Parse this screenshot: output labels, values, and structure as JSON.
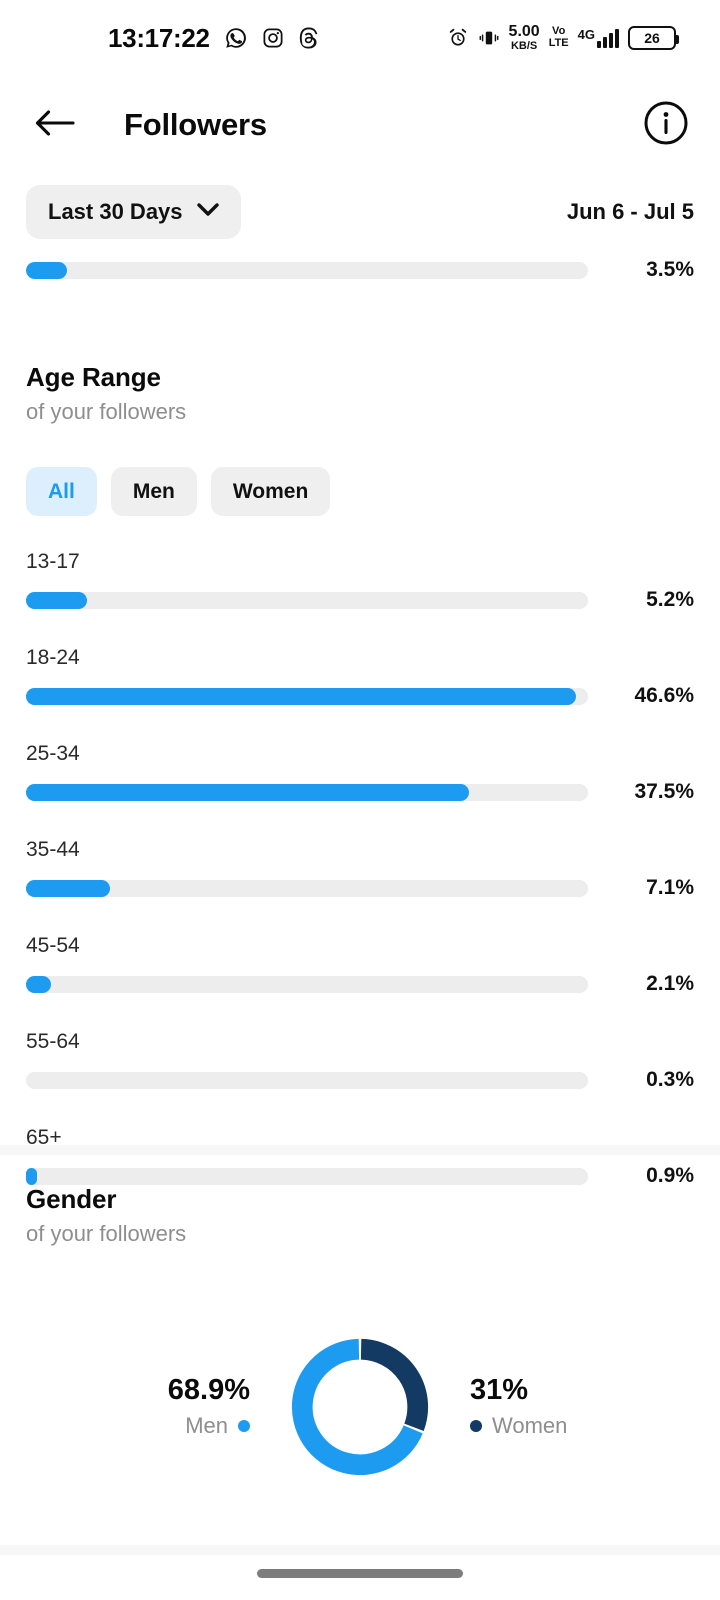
{
  "status_bar": {
    "time": "13:17:22",
    "left_icons": [
      "whatsapp-icon",
      "instagram-icon",
      "threads-icon"
    ],
    "alarm_icon": "alarm-icon",
    "vibrate_icon": "vibrate-icon",
    "net_speed_value": "5.00",
    "net_speed_unit": "KB/S",
    "volte_line1": "Vo",
    "volte_line2": "LTE",
    "network_type": "4G",
    "signal_bars": 4,
    "battery_level": "26"
  },
  "header": {
    "back_icon": "back-arrow-icon",
    "title": "Followers",
    "info_icon": "info-icon"
  },
  "filter": {
    "date_chip_label": "Last 30 Days",
    "chevron_icon": "chevron-down-icon",
    "date_range": "Jun 6 - Jul 5"
  },
  "clipped_top_row": {
    "value": "3.5%",
    "percent": 3.5
  },
  "age_section": {
    "title": "Age Range",
    "subtitle": "of your followers",
    "tabs": [
      {
        "label": "All",
        "selected": true
      },
      {
        "label": "Men",
        "selected": false
      },
      {
        "label": "Women",
        "selected": false
      }
    ]
  },
  "gender_section": {
    "title": "Gender",
    "subtitle": "of your followers",
    "men_value": "68.9%",
    "men_label": "Men",
    "women_value": "31%",
    "women_label": "Women"
  },
  "colors": {
    "accent_blue": "#1d9bf0",
    "accent_blue_soft": "#ddeffd",
    "navy": "#123a63",
    "track_gray": "#ededed",
    "chip_gray": "#efefef",
    "muted_text": "#8e8e8e"
  },
  "chart_data": [
    {
      "type": "bar",
      "title": "Age Range",
      "subtitle": "of your followers",
      "orientation": "horizontal",
      "xlabel": "",
      "ylabel": "",
      "xlim": [
        0,
        100
      ],
      "grid": false,
      "legend": "none",
      "unit": "%",
      "categories": [
        "13-17",
        "18-24",
        "25-34",
        "35-44",
        "45-54",
        "55-64",
        "65+"
      ],
      "values": [
        5.2,
        46.6,
        37.5,
        7.1,
        2.1,
        0.3,
        0.9
      ],
      "labels": [
        "5.2%",
        "46.6%",
        "37.5%",
        "7.1%",
        "2.1%",
        "0.3%",
        "0.9%"
      ]
    },
    {
      "type": "pie",
      "variant": "donut",
      "title": "Gender",
      "subtitle": "of your followers",
      "legend": "sides",
      "unit": "%",
      "categories": [
        "Men",
        "Women"
      ],
      "values": [
        68.9,
        31.0
      ],
      "labels": [
        "68.9%",
        "31%"
      ],
      "colors": [
        "#1d9bf0",
        "#123a63"
      ]
    }
  ]
}
